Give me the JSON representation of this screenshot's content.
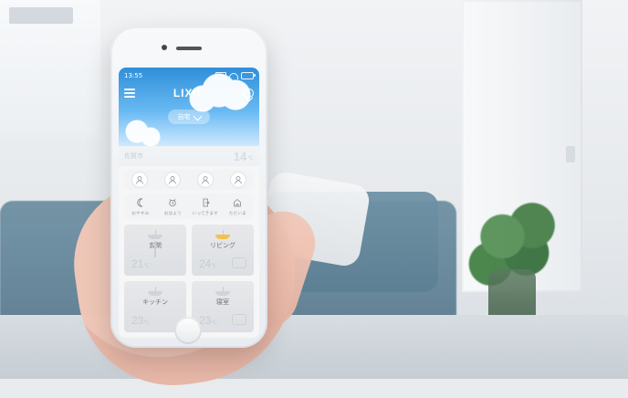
{
  "status_bar": {
    "time": "13:55"
  },
  "app": {
    "brand": "LIXIL",
    "location_pill": "自宅"
  },
  "weather": {
    "city": "佐賀市",
    "temperature": "14",
    "unit": "℃"
  },
  "modes": [
    {
      "label": "おやすみ",
      "icon": "moon-icon"
    },
    {
      "label": "おはよう",
      "icon": "alarm-clock-icon"
    },
    {
      "label": "いってきます",
      "icon": "door-exit-icon"
    },
    {
      "label": "ただいま",
      "icon": "house-icon"
    }
  ],
  "rooms": [
    {
      "name": "玄関",
      "temp": "21",
      "unit": "℃"
    },
    {
      "name": "リビング",
      "temp": "24",
      "unit": "℃"
    },
    {
      "name": "キッチン",
      "temp": "23",
      "unit": "℃"
    },
    {
      "name": "寝室",
      "temp": "23",
      "unit": "℃"
    }
  ],
  "colors": {
    "sky_top": "#2f8fd9",
    "sky_bottom": "#cfe9ff",
    "accent_light_on": "#f2c14e"
  }
}
